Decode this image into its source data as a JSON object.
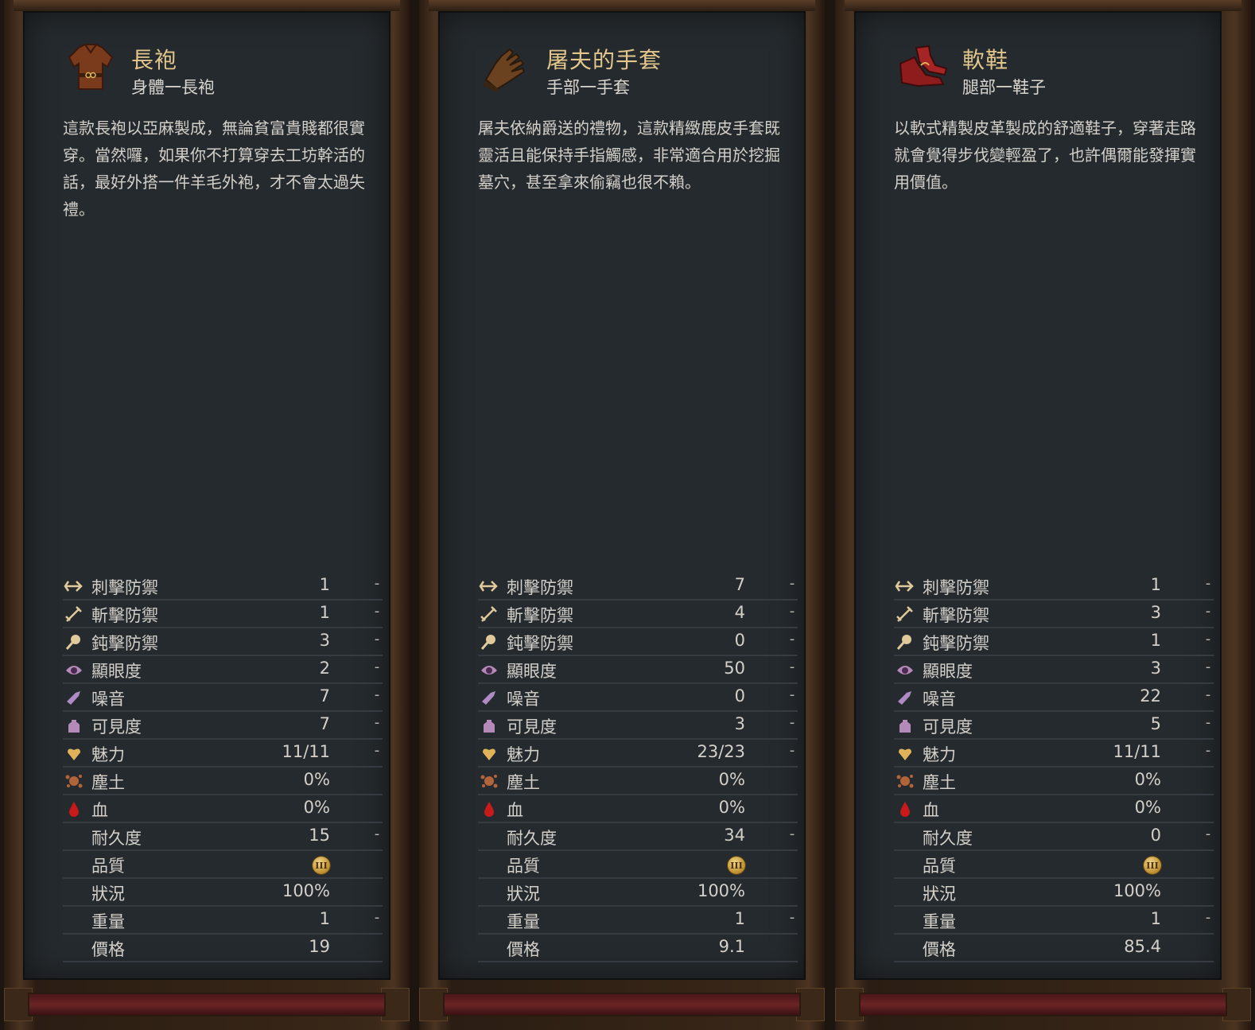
{
  "labels": {
    "pierce": "刺擊防禦",
    "slash": "斬擊防禦",
    "blunt": "鈍擊防禦",
    "conspicuousness": "顯眼度",
    "noise": "噪音",
    "visibility": "可見度",
    "charisma": "魅力",
    "dirt": "塵土",
    "blood": "血",
    "durability": "耐久度",
    "quality": "品質",
    "condition": "狀況",
    "weight": "重量",
    "price": "價格"
  },
  "icons": {
    "pierce": "arrow-pierce-icon",
    "slash": "sword-slash-icon",
    "blunt": "mace-blunt-icon",
    "conspicuousness": "eye-conspicuousness-icon",
    "noise": "horn-noise-icon",
    "visibility": "lamp-visibility-icon",
    "charisma": "heart-charisma-icon",
    "dirt": "dirt-splat-icon",
    "blood": "blood-drop-icon",
    "quality": "quality-badge-icon"
  },
  "colors": {
    "title": "#e2c68c",
    "text": "#d3d0c9",
    "panel": "#252a2e",
    "frame": "#3a2818"
  },
  "items": [
    {
      "name": "長袍",
      "slot": "身體一長袍",
      "icon": "robe-icon",
      "description": "這款長袍以亞麻製成，無論貧富貴賤都很實穿。當然囉，如果你不打算穿去工坊幹活的話，最好外搭一件羊毛外袍，才不會太過失禮。",
      "stats": {
        "pierce": "1",
        "pierce_diff": "-",
        "slash": "1",
        "slash_diff": "-",
        "blunt": "3",
        "blunt_diff": "-",
        "conspicuousness": "2",
        "conspicuousness_diff": "-",
        "noise": "7",
        "noise_diff": "-",
        "visibility": "7",
        "visibility_diff": "-",
        "charisma": "11/11",
        "charisma_diff": "-",
        "dirt": "0%",
        "blood": "0%",
        "durability": "15",
        "durability_diff": "-",
        "quality": "III",
        "condition": "100%",
        "weight": "1",
        "weight_diff": "-",
        "price": "19"
      }
    },
    {
      "name": "屠夫的手套",
      "slot": "手部一手套",
      "icon": "gloves-icon",
      "description": "屠夫依納爵送的禮物，這款精緻鹿皮手套既靈活且能保持手指觸感，非常適合用於挖掘墓穴，甚至拿來偷竊也很不賴。",
      "stats": {
        "pierce": "7",
        "pierce_diff": "-",
        "slash": "4",
        "slash_diff": "-",
        "blunt": "0",
        "blunt_diff": "-",
        "conspicuousness": "50",
        "conspicuousness_diff": "-",
        "noise": "0",
        "noise_diff": "-",
        "visibility": "3",
        "visibility_diff": "-",
        "charisma": "23/23",
        "charisma_diff": "-",
        "dirt": "0%",
        "blood": "0%",
        "durability": "34",
        "durability_diff": "-",
        "quality": "III",
        "condition": "100%",
        "weight": "1",
        "weight_diff": "-",
        "price": "9.1"
      }
    },
    {
      "name": "軟鞋",
      "slot": "腿部一鞋子",
      "icon": "shoes-icon",
      "description": "以軟式精製皮革製成的舒適鞋子，穿著走路就會覺得步伐變輕盈了，也許偶爾能發揮實用價值。",
      "stats": {
        "pierce": "1",
        "pierce_diff": "-",
        "slash": "3",
        "slash_diff": "-",
        "blunt": "1",
        "blunt_diff": "-",
        "conspicuousness": "3",
        "conspicuousness_diff": "-",
        "noise": "22",
        "noise_diff": "-",
        "visibility": "5",
        "visibility_diff": "-",
        "charisma": "11/11",
        "charisma_diff": "-",
        "dirt": "0%",
        "blood": "0%",
        "durability": "0",
        "durability_diff": "-",
        "quality": "III",
        "condition": "100%",
        "weight": "1",
        "weight_diff": "-",
        "price": "85.4"
      }
    }
  ]
}
